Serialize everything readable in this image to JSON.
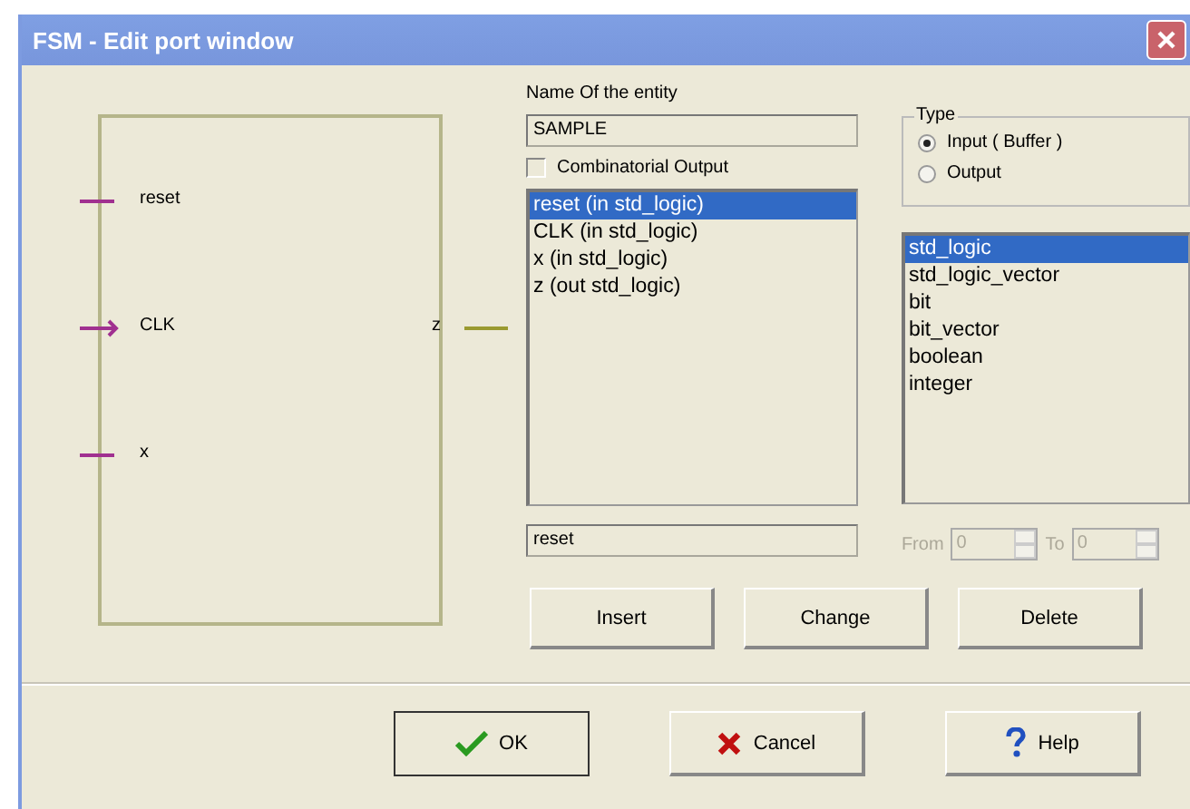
{
  "window": {
    "title": "FSM - Edit port window"
  },
  "diagram": {
    "ports": [
      {
        "name": "reset",
        "kind": "input",
        "clock": false
      },
      {
        "name": "CLK",
        "kind": "input",
        "clock": true
      },
      {
        "name": "x",
        "kind": "input",
        "clock": false
      },
      {
        "name": "z",
        "kind": "output",
        "clock": false
      }
    ]
  },
  "entity": {
    "label": "Name Of the entity",
    "value": "SAMPLE"
  },
  "combinatorial": {
    "label": "Combinatorial Output",
    "checked": false
  },
  "ports_list": [
    {
      "label": "reset (in std_logic)",
      "selected": true
    },
    {
      "label": "CLK (in std_logic)",
      "selected": false
    },
    {
      "label": "x (in std_logic)",
      "selected": false
    },
    {
      "label": "z (out std_logic)",
      "selected": false
    }
  ],
  "port_name": {
    "value": "reset"
  },
  "type_group": {
    "title": "Type",
    "options": [
      {
        "label": "Input ( Buffer )",
        "selected": true
      },
      {
        "label": "Output",
        "selected": false
      }
    ]
  },
  "types_list": [
    {
      "label": "std_logic",
      "selected": true
    },
    {
      "label": "std_logic_vector",
      "selected": false
    },
    {
      "label": "bit",
      "selected": false
    },
    {
      "label": "bit_vector",
      "selected": false
    },
    {
      "label": "boolean",
      "selected": false
    },
    {
      "label": "integer",
      "selected": false
    }
  ],
  "range": {
    "from_label": "From",
    "from_value": "0",
    "to_label": "To",
    "to_value": "0",
    "disabled": true
  },
  "edit_buttons": [
    "Insert",
    "Change",
    "Delete"
  ],
  "dialog_buttons": [
    {
      "label": "OK",
      "kind": "ok"
    },
    {
      "label": "Cancel",
      "kind": "cancel"
    },
    {
      "label": "Help",
      "kind": "help"
    }
  ]
}
